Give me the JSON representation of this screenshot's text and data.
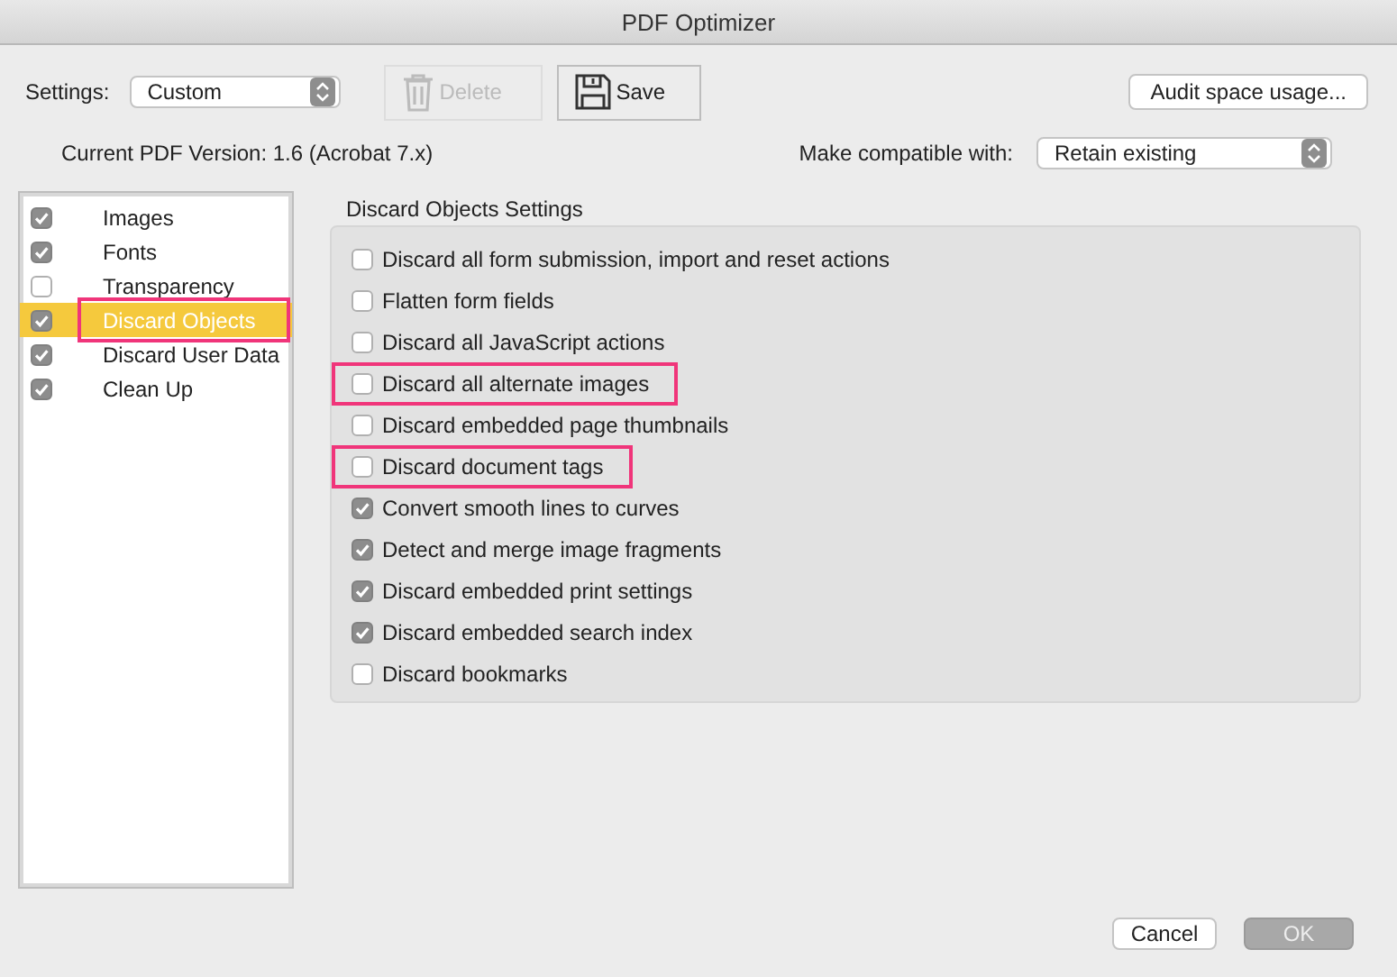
{
  "window": {
    "title": "PDF Optimizer"
  },
  "toolbar": {
    "settings_label": "Settings:",
    "settings_value": "Custom",
    "delete_button": {
      "label": "Delete",
      "disabled": true
    },
    "save_button": {
      "label": "Save",
      "disabled": false
    },
    "audit_button": "Audit space usage..."
  },
  "version": {
    "text": "Current PDF Version: 1.6 (Acrobat 7.x)",
    "compat_label": "Make compatible with:",
    "compat_value": "Retain existing"
  },
  "sidebar": {
    "items": [
      {
        "label": "Images",
        "checked": true,
        "selected": false,
        "highlighted": false
      },
      {
        "label": "Fonts",
        "checked": true,
        "selected": false,
        "highlighted": false
      },
      {
        "label": "Transparency",
        "checked": false,
        "selected": false,
        "highlighted": false
      },
      {
        "label": "Discard Objects",
        "checked": true,
        "selected": true,
        "highlighted": true
      },
      {
        "label": "Discard User Data",
        "checked": true,
        "selected": false,
        "highlighted": false
      },
      {
        "label": "Clean Up",
        "checked": true,
        "selected": false,
        "highlighted": false
      }
    ]
  },
  "panel": {
    "title": "Discard Objects Settings",
    "options": [
      {
        "label": "Discard all form submission, import and reset actions",
        "checked": false,
        "highlighted": false
      },
      {
        "label": "Flatten form fields",
        "checked": false,
        "highlighted": false
      },
      {
        "label": "Discard all JavaScript actions",
        "checked": false,
        "highlighted": false
      },
      {
        "label": "Discard all alternate images",
        "checked": false,
        "highlighted": true
      },
      {
        "label": "Discard embedded page thumbnails",
        "checked": false,
        "highlighted": false
      },
      {
        "label": "Discard document tags",
        "checked": false,
        "highlighted": true
      },
      {
        "label": "Convert smooth lines to curves",
        "checked": true,
        "highlighted": false
      },
      {
        "label": "Detect and merge image fragments",
        "checked": true,
        "highlighted": false
      },
      {
        "label": "Discard embedded print settings",
        "checked": true,
        "highlighted": false
      },
      {
        "label": "Discard embedded search index",
        "checked": true,
        "highlighted": false
      },
      {
        "label": "Discard bookmarks",
        "checked": false,
        "highlighted": false
      }
    ]
  },
  "footer": {
    "cancel_button": {
      "label": "Cancel",
      "disabled": false
    },
    "ok_button": {
      "label": "OK",
      "disabled": true
    }
  }
}
